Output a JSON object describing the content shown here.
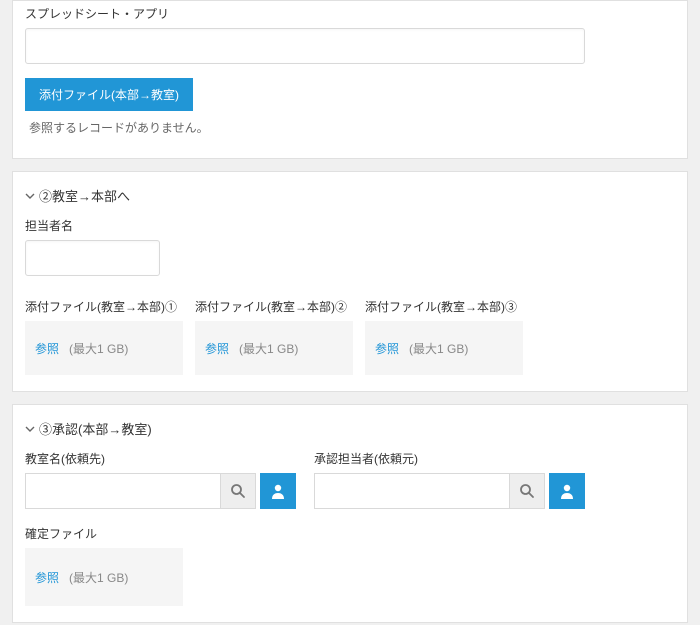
{
  "section1": {
    "spreadsheet_app_label": "スプレッドシート・アプリ",
    "attach_tab_label": "添付ファイル(本部→教室)",
    "no_record_msg": "参照するレコードがありません。"
  },
  "section2": {
    "title": "②教室→本部へ",
    "person_label": "担当者名",
    "attach_cols": [
      {
        "label": "添付ファイル(教室→本部)①",
        "browse": "参照",
        "max": "(最大1 GB)"
      },
      {
        "label": "添付ファイル(教室→本部)②",
        "browse": "参照",
        "max": "(最大1 GB)"
      },
      {
        "label": "添付ファイル(教室→本部)③",
        "browse": "参照",
        "max": "(最大1 GB)"
      }
    ]
  },
  "section3": {
    "title": "③承認(本部→教室)",
    "dest_label": "教室名(依頼先)",
    "approver_label": "承認担当者(依頼元)",
    "confirm_label": "確定ファイル",
    "browse": "参照",
    "max": "(最大1 GB)"
  }
}
